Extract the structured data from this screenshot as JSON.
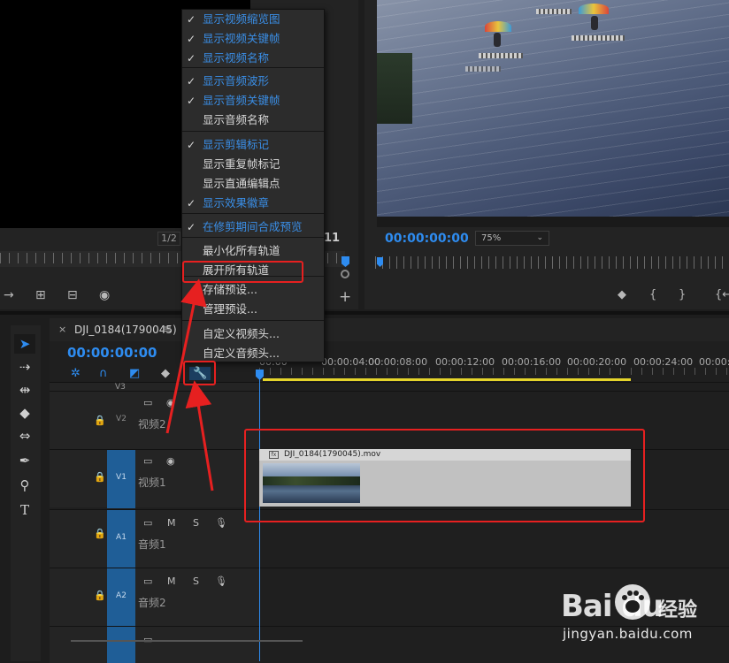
{
  "source_monitor": {
    "page_indicator": "1/2",
    "timecode_right": "11",
    "controls": [
      "mark-in",
      "lift",
      "extract",
      "export-frame",
      "add"
    ]
  },
  "program_monitor": {
    "timecode": "00:00:00:00",
    "zoom": "75%",
    "controls": [
      "marker",
      "mark-in",
      "mark-out",
      "go-to-in"
    ]
  },
  "timeline": {
    "sequence_name": "DJI_0184(1790045)",
    "close_label": "×",
    "menu_label": "≡",
    "timecode": "00:00:00:00",
    "ruler_labels": [
      "00:00",
      "00:00:04:00",
      "00:00:08:00",
      "00:00:12:00",
      "00:00:16:00",
      "00:00:20:00",
      "00:00:24:00",
      "00:00:2"
    ],
    "tracks": [
      {
        "id": "V3",
        "name": ""
      },
      {
        "id": "V2",
        "name": "视频2"
      },
      {
        "id": "V1",
        "name": "视频1"
      },
      {
        "id": "A1",
        "name": "音频1"
      },
      {
        "id": "A2",
        "name": "音频2"
      }
    ],
    "audio_buttons": [
      "M",
      "S"
    ],
    "clip": {
      "name": "DJI_0184(1790045).mov",
      "fx": "fx"
    }
  },
  "context_menu": {
    "items": [
      {
        "label": "显示视频缩览图",
        "checked": true
      },
      {
        "label": "显示视频关键帧",
        "checked": true
      },
      {
        "label": "显示视频名称",
        "checked": true
      },
      {
        "label": "显示音频波形",
        "checked": true
      },
      {
        "label": "显示音频关键帧",
        "checked": true
      },
      {
        "label": "显示音频名称",
        "checked": false
      },
      {
        "label": "显示剪辑标记",
        "checked": true
      },
      {
        "label": "显示重复帧标记",
        "checked": false
      },
      {
        "label": "显示直通编辑点",
        "checked": false
      },
      {
        "label": "显示效果徽章",
        "checked": true
      },
      {
        "label": "在修剪期间合成预览",
        "checked": true
      },
      {
        "label": "最小化所有轨道",
        "checked": false
      },
      {
        "label": "展开所有轨道",
        "checked": false
      },
      {
        "label": "存储预设...",
        "checked": false
      },
      {
        "label": "管理预设...",
        "checked": false
      },
      {
        "label": "自定义视频头...",
        "checked": false
      },
      {
        "label": "自定义音频头...",
        "checked": false
      }
    ]
  },
  "watermark": {
    "brand": "Bai du",
    "cn": "经验",
    "url": "jingyan.baidu.com"
  },
  "colors": {
    "accent": "#2e8cf0",
    "annotation": "#e62020",
    "work_area": "#e5d42b",
    "track_target": "#1f5e97"
  },
  "icons": {
    "check": "✓",
    "wrench": "wrench-icon",
    "lock": "lock-icon",
    "eye": "eye-icon",
    "mic": "microphone-icon"
  }
}
